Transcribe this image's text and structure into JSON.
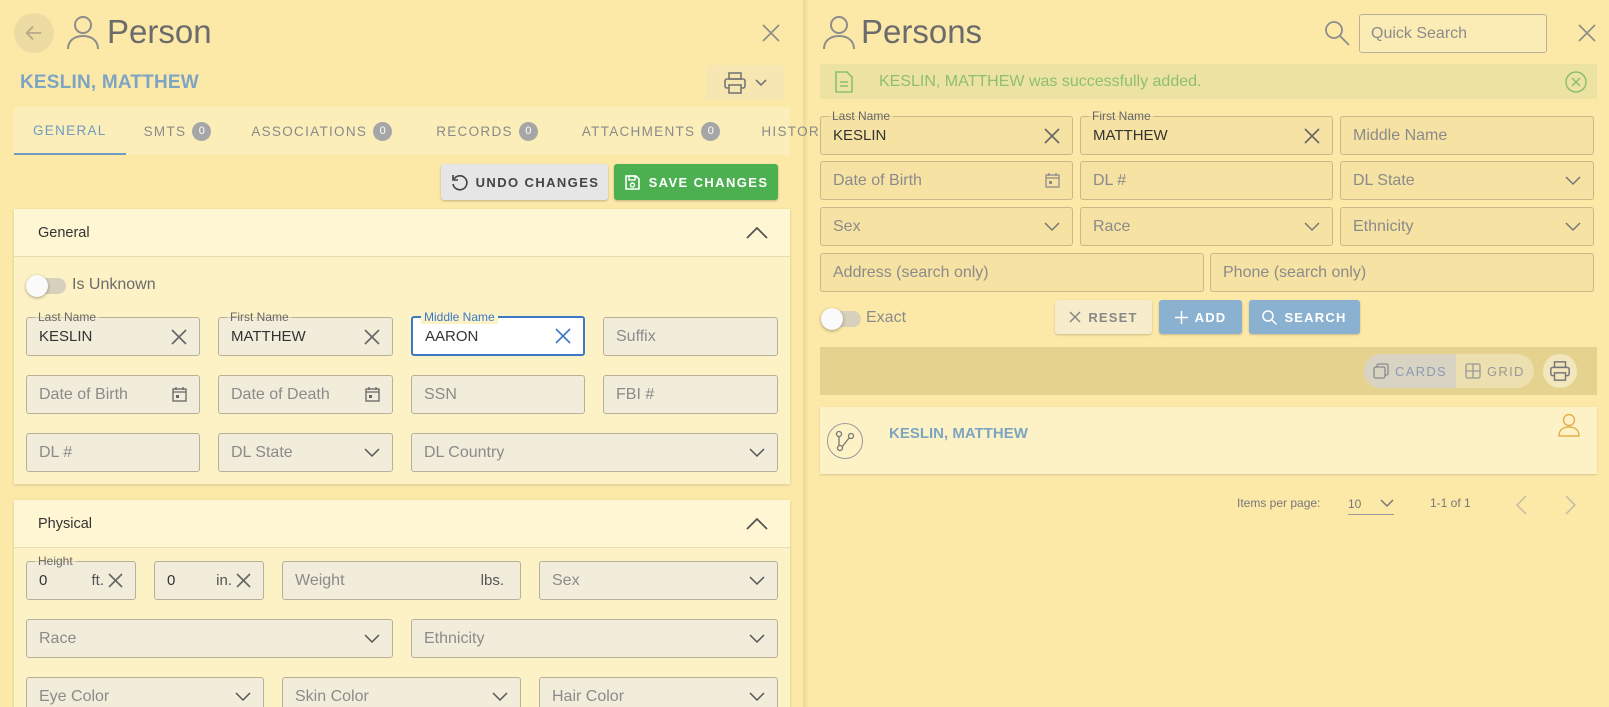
{
  "left_panel": {
    "title": "Person",
    "person_name": "KESLIN, MATTHEW",
    "tabs": [
      {
        "label": "GENERAL",
        "badge": ""
      },
      {
        "label": "SMTS",
        "badge": "0"
      },
      {
        "label": "ASSOCIATIONS",
        "badge": "0"
      },
      {
        "label": "RECORDS",
        "badge": "0"
      },
      {
        "label": "ATTACHMENTS",
        "badge": "0"
      },
      {
        "label": "HISTORY",
        "badge": ""
      }
    ],
    "undo_label": "UNDO CHANGES",
    "save_label": "SAVE CHANGES",
    "general": {
      "title": "General",
      "is_unknown_label": "Is Unknown",
      "last_name": {
        "label": "Last Name",
        "value": "KESLIN"
      },
      "first_name": {
        "label": "First Name",
        "value": "MATTHEW"
      },
      "middle_name": {
        "label": "Middle Name",
        "value": "AARON"
      },
      "suffix_placeholder": "Suffix",
      "dob_placeholder": "Date of Birth",
      "dod_placeholder": "Date of Death",
      "ssn_placeholder": "SSN",
      "fbi_placeholder": "FBI #",
      "dl_placeholder": "DL #",
      "dl_state_placeholder": "DL State",
      "dl_country_placeholder": "DL Country"
    },
    "physical": {
      "title": "Physical",
      "height_label": "Height",
      "height_ft": "0",
      "ft_unit": "ft.",
      "height_in": "0",
      "in_unit": "in.",
      "weight_placeholder": "Weight",
      "weight_unit": "lbs.",
      "sex_placeholder": "Sex",
      "race_placeholder": "Race",
      "ethnicity_placeholder": "Ethnicity",
      "eye_color_placeholder": "Eye Color",
      "skin_color_placeholder": "Skin Color",
      "hair_color_placeholder": "Hair Color"
    }
  },
  "right_panel": {
    "title": "Persons",
    "quick_search_placeholder": "Quick Search",
    "alert_text": "KESLIN, MATTHEW was successfully added.",
    "search": {
      "last_name": {
        "label": "Last Name",
        "value": "KESLIN"
      },
      "first_name": {
        "label": "First Name",
        "value": "MATTHEW"
      },
      "middle_name_placeholder": "Middle Name",
      "dob_placeholder": "Date of Birth",
      "dl_placeholder": "DL #",
      "dl_state_placeholder": "DL State",
      "sex_placeholder": "Sex",
      "race_placeholder": "Race",
      "ethnicity_placeholder": "Ethnicity",
      "address_placeholder": "Address (search only)",
      "phone_placeholder": "Phone (search only)",
      "exact_label": "Exact",
      "reset_label": "RESET",
      "add_label": "ADD",
      "search_label": "SEARCH"
    },
    "view": {
      "cards_label": "CARDS",
      "grid_label": "GRID",
      "active": "cards"
    },
    "results": [
      {
        "name": "KESLIN, MATTHEW"
      }
    ],
    "paginator": {
      "items_per_page_label": "Items per page:",
      "page_size": "10",
      "range_label": "1-1 of 1"
    }
  },
  "colors": {
    "background": "#fce9a8",
    "accent_blue": "#6e9ac4",
    "save_green": "#4caf50",
    "alert_text": "#8fbf6e",
    "link_blue": "#7ea4c4"
  }
}
